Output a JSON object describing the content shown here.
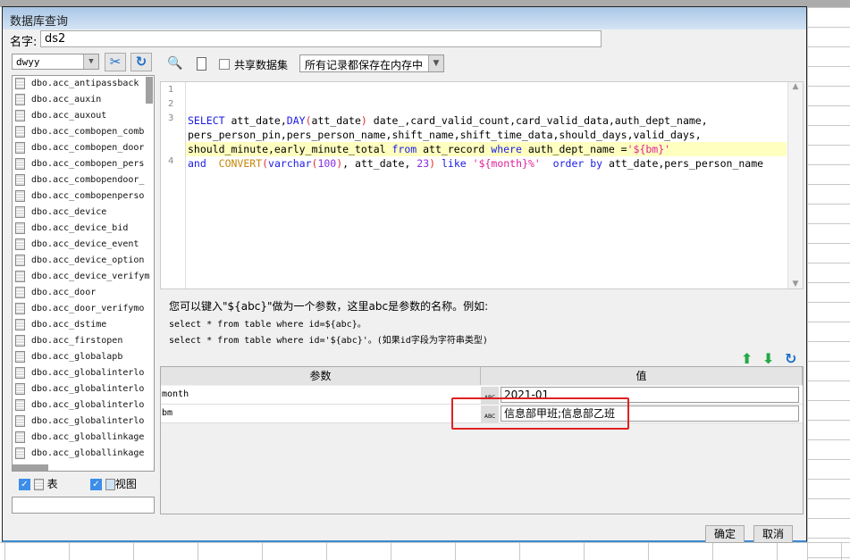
{
  "dialog": {
    "title": "数据库查询",
    "name_label": "名字:",
    "name_value": "ds2"
  },
  "left": {
    "db_select": "dwyy",
    "tables": [
      "dbo.acc_antipassback",
      "dbo.acc_auxin",
      "dbo.acc_auxout",
      "dbo.acc_combopen_comb",
      "dbo.acc_combopen_door",
      "dbo.acc_combopen_pers",
      "dbo.acc_combopendoor_",
      "dbo.acc_combopenperso",
      "dbo.acc_device",
      "dbo.acc_device_bid",
      "dbo.acc_device_event",
      "dbo.acc_device_option",
      "dbo.acc_device_verifym",
      "dbo.acc_door",
      "dbo.acc_door_verifymo",
      "dbo.acc_dstime",
      "dbo.acc_firstopen",
      "dbo.acc_globalapb",
      "dbo.acc_globalinterlo",
      "dbo.acc_globalinterlo",
      "dbo.acc_globalinterlo",
      "dbo.acc_globalinterlo",
      "dbo.acc_globallinkage",
      "dbo.acc_globallinkage"
    ],
    "show_tables_label": "表",
    "show_views_label": "视图",
    "show_tables_checked": true,
    "show_views_checked": true
  },
  "toolbar": {
    "share_label": "共享数据集",
    "share_checked": false,
    "storage_select": "所有记录都保存在内存中"
  },
  "editor": {
    "line_numbers": [
      "1",
      "2",
      "3",
      "4"
    ],
    "lines": [
      [],
      [],
      [
        {
          "t": "SELECT",
          "c": "kw"
        },
        {
          "t": " att_date,"
        },
        {
          "t": "DAY",
          "c": "kw"
        },
        {
          "t": "(",
          "c": "pr"
        },
        {
          "t": "att_date"
        },
        {
          "t": ")",
          "c": "pr"
        },
        {
          "t": " date_,card_valid_count,card_valid_data,auth_dept_name,"
        }
      ],
      [
        {
          "t": "pers_person_pin,pers_person_name,shift_name,shift_time_data,should_days,valid_days,"
        }
      ],
      [
        {
          "t": "should_minute,early_minute_total "
        },
        {
          "t": "from",
          "c": "kw"
        },
        {
          "t": " att_record "
        },
        {
          "t": "where",
          "c": "kw"
        },
        {
          "t": " auth_dept_name ="
        },
        {
          "t": "'${bm}'",
          "c": "st"
        }
      ],
      [
        {
          "t": "and",
          "c": "kw"
        },
        {
          "t": "  "
        },
        {
          "t": "CONVERT",
          "c": "fn"
        },
        {
          "t": "(",
          "c": "pr"
        },
        {
          "t": "varchar",
          "c": "kw"
        },
        {
          "t": "(",
          "c": "pr"
        },
        {
          "t": "100",
          "c": "nm"
        },
        {
          "t": ")",
          "c": "pr"
        },
        {
          "t": ", att_date, "
        },
        {
          "t": "23",
          "c": "nm"
        },
        {
          "t": ")",
          "c": "pr"
        },
        {
          "t": " "
        },
        {
          "t": "like",
          "c": "kw"
        },
        {
          "t": " "
        },
        {
          "t": "'${month}%'",
          "c": "st"
        },
        {
          "t": "  "
        },
        {
          "t": "order by",
          "c": "kw"
        },
        {
          "t": " att_date,pers_person_name"
        }
      ]
    ]
  },
  "info": {
    "line1": "您可以键入\"${abc}\"做为一个参数，这里abc是参数的名称。例如:",
    "line2": "select * from table where id=${abc}。",
    "line3": "select * from table where id='${abc}'。(如果id字段为字符串类型)"
  },
  "params": {
    "col_param": "参数",
    "col_value": "值",
    "rows": [
      {
        "name": "month",
        "value": "2021-01"
      },
      {
        "name": "bm",
        "value": "信息部甲班;信息部乙班"
      }
    ]
  },
  "buttons": {
    "ok": "确定",
    "cancel": "取消"
  },
  "colors": {
    "keyword": "#1a1ae6",
    "string": "#e0209a",
    "highlight": "#ffffc0",
    "annotation": "#e02020"
  }
}
